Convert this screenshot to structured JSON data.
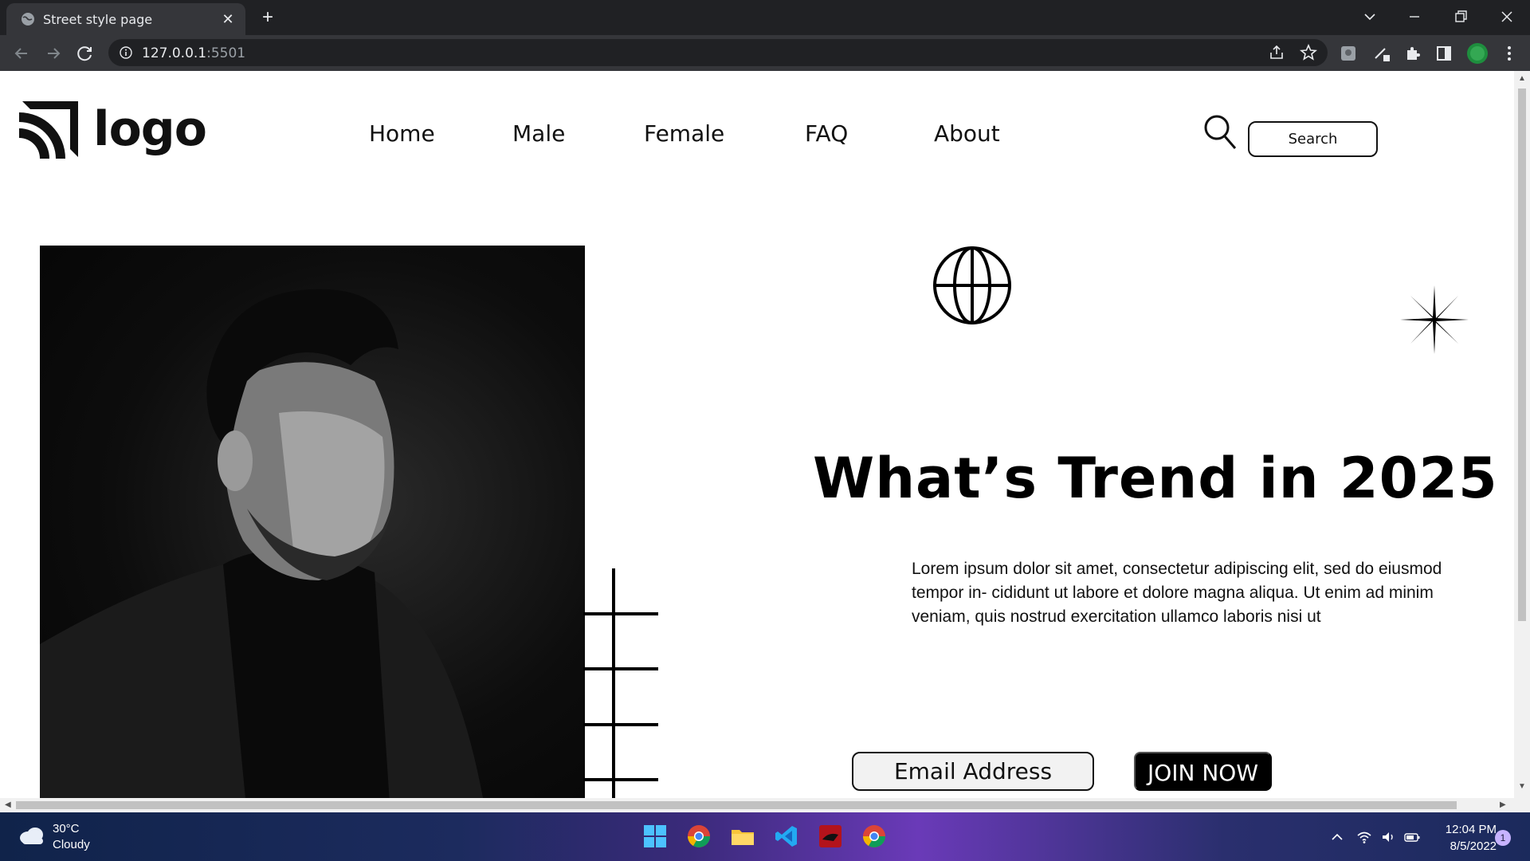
{
  "browser": {
    "tab_title": "Street style page",
    "url_host": "127.0.0.1",
    "url_port": ":5501"
  },
  "header": {
    "logo_text": "logo",
    "nav": [
      "Home",
      "Male",
      "Female",
      "FAQ",
      "About"
    ],
    "search_label": "Search"
  },
  "hero": {
    "headline": "What’s Trend in 2025 ?",
    "body": "Lorem ipsum dolor sit amet, consectetur adipiscing elit, sed do eiusmod tempor in- cididunt ut labore et dolore magna aliqua. Ut enim ad minim veniam, quis nostrud exercitation ullamco laboris nisi ut",
    "email_placeholder": "Email Address",
    "join_label": "JOIN NOW"
  },
  "taskbar": {
    "weather_temp": "30°C",
    "weather_desc": "Cloudy",
    "time": "12:04 PM",
    "date": "8/5/2022",
    "notification_count": "1"
  },
  "colors": {
    "chrome_dark": "#202124",
    "chrome_toolbar": "#35363a",
    "page_bg": "#ffffff",
    "accent_black": "#000000"
  }
}
